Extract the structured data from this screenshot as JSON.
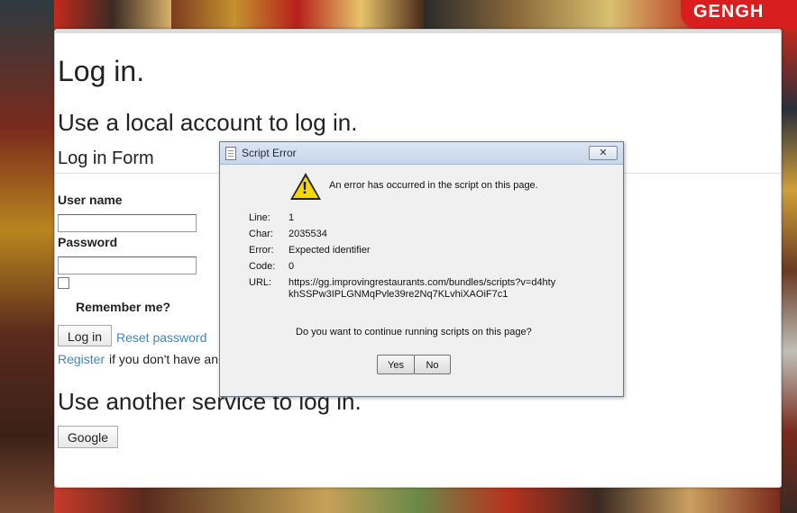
{
  "brand": {
    "text": "GENGH"
  },
  "page": {
    "title": "Log in.",
    "subtitle": "Use a local account to log in.",
    "form_heading": "Log in Form",
    "username_label": "User name",
    "password_label": "Password",
    "remember_label": "Remember me?",
    "login_button": "Log in",
    "reset_link": "Reset password",
    "register_link": "Register",
    "register_suffix": "if you don't have an",
    "other_heading": "Use another service to log in.",
    "google_button": "Google"
  },
  "dialog": {
    "title": "Script Error",
    "close": "✕",
    "message": "An error has occurred in the script on this page.",
    "line_label": "Line:",
    "line_value": "1",
    "char_label": "Char:",
    "char_value": "2035534",
    "error_label": "Error:",
    "error_value": "Expected identifier",
    "code_label": "Code:",
    "code_value": "0",
    "url_label": "URL:",
    "url_value": "https://gg.improvingrestaurants.com/bundles/scripts?v=d4htykhSSPw3IPLGNMqPvle39re2Nq7KLvhiXAOiF7c1",
    "question": "Do you want to continue running scripts on this page?",
    "yes_label": "Yes",
    "no_label": "No"
  }
}
